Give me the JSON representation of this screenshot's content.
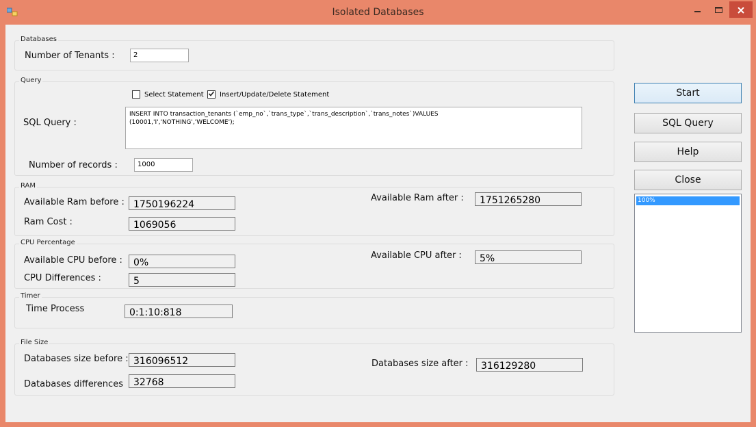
{
  "window": {
    "title": "Isolated Databases",
    "title_bar_color": "#e9876a",
    "close_button_color": "#c94c3b"
  },
  "databases": {
    "legend": "Databases",
    "tenants_label": "Number of Tenants :",
    "tenants_value": "2"
  },
  "query": {
    "legend": "Query",
    "select_label": "Select Statement",
    "select_checked": false,
    "modify_label": "Insert/Update/Delete Statement",
    "modify_checked": true,
    "sql_label": "SQL Query :",
    "sql_line1": "INSERT INTO transaction_tenants (`emp_no`,`trans_type`,`trans_description`,`trans_notes`)VALUES",
    "sql_line2": "(10001,'I','NOTHING','WELCOME');",
    "records_label": "Number of records :",
    "records_value": "1000"
  },
  "ram": {
    "legend": "RAM",
    "before_label": "Available Ram before :",
    "before_value": "1750196224",
    "after_label": "Available Ram after :",
    "after_value": "1751265280",
    "cost_label": "Ram Cost :",
    "cost_value": "1069056"
  },
  "cpu": {
    "legend": "CPU Percentage",
    "before_label": "Available CPU  before :",
    "before_value": "0%",
    "after_label": "Available CPU after :",
    "after_value": "5%",
    "diff_label": "CPU Differences :",
    "diff_value": "5"
  },
  "timer": {
    "legend": "Timer",
    "label": "Time Process",
    "value": "0:1:10:818"
  },
  "filesize": {
    "legend": "File Size",
    "before_label": "Databases size before :",
    "before_value": "316096512",
    "after_label": "Databases size after :",
    "after_value": "316129280",
    "diff_label": "Databases differences",
    "diff_value": "32768"
  },
  "buttons": {
    "start": "Start",
    "sql_query": "SQL Query",
    "help": "Help",
    "close": "Close"
  },
  "progress_list": {
    "items": [
      "100%"
    ],
    "selected_color": "#3399ff"
  },
  "icons": {
    "app": "app-window-icon",
    "minimize": "minimize-icon",
    "maximize": "maximize-icon",
    "close": "close-icon",
    "check": "checkmark-icon"
  }
}
